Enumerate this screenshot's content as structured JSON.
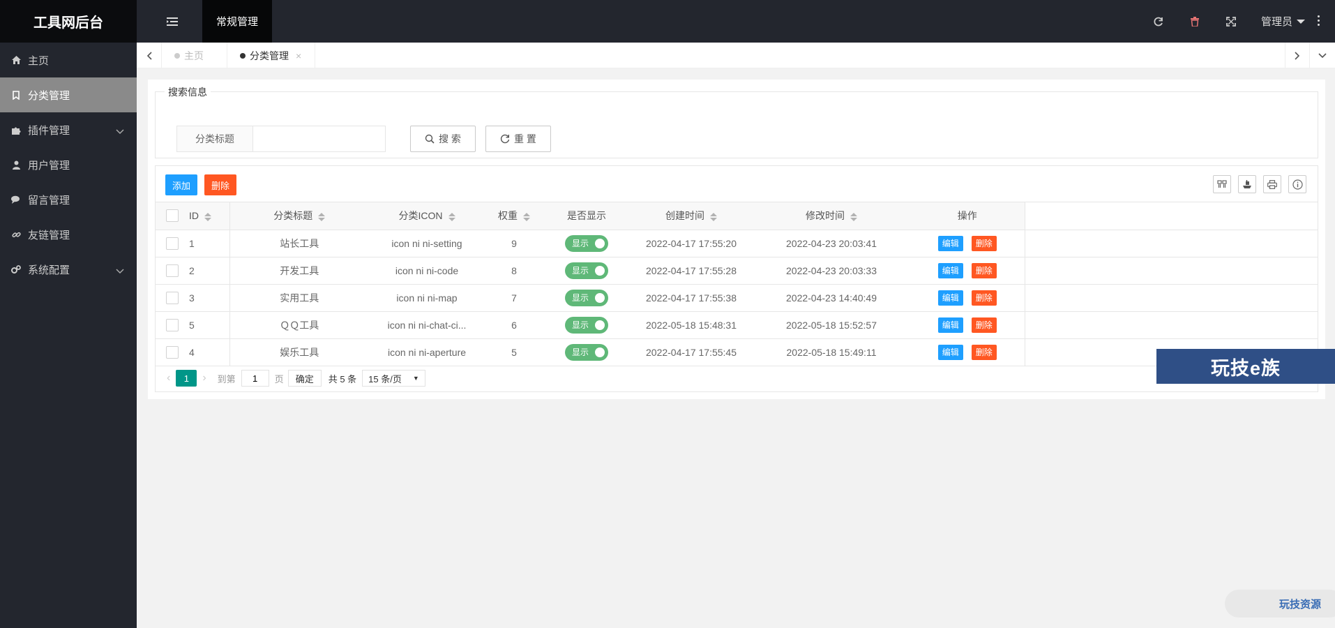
{
  "app": {
    "logo": "工具网后台",
    "top_tab": "常规管理",
    "admin_label": "管理员"
  },
  "icons": {
    "menu_toggle": "indent-icon",
    "refresh": "refresh-icon",
    "clear": "trash-icon",
    "fullscreen": "fullscreen-icon",
    "more": "more-vertical-icon"
  },
  "sidebar": {
    "items": [
      {
        "label": "主页",
        "icon": "home-icon"
      },
      {
        "label": "分类管理",
        "icon": "bookmark-icon",
        "active": true
      },
      {
        "label": "插件管理",
        "icon": "puzzle-icon",
        "expandable": true
      },
      {
        "label": "用户管理",
        "icon": "user-icon"
      },
      {
        "label": "留言管理",
        "icon": "chat-icon"
      },
      {
        "label": "友链管理",
        "icon": "link-icon"
      },
      {
        "label": "系统配置",
        "icon": "gears-icon",
        "expandable": true
      }
    ]
  },
  "tabs": {
    "home": "主页",
    "current": "分类管理"
  },
  "search": {
    "legend": "搜索信息",
    "field_label": "分类标题",
    "field_value": "",
    "search_btn": "搜 索",
    "reset_btn": "重 置"
  },
  "toolbar": {
    "add": "添加",
    "delete": "删除"
  },
  "table": {
    "headers": {
      "id": "ID",
      "title": "分类标题",
      "icon": "分类ICON",
      "weight": "权重",
      "show": "是否显示",
      "created": "创建时间",
      "modified": "修改时间",
      "ops": "操作"
    },
    "rows": [
      {
        "id": "1",
        "title": "站长工具",
        "icon": "icon ni ni-setting",
        "weight": "9",
        "show": "显示",
        "created": "2022-04-17 17:55:20",
        "modified": "2022-04-23 20:03:41"
      },
      {
        "id": "2",
        "title": "开发工具",
        "icon": "icon ni ni-code",
        "weight": "8",
        "show": "显示",
        "created": "2022-04-17 17:55:28",
        "modified": "2022-04-23 20:03:33"
      },
      {
        "id": "3",
        "title": "实用工具",
        "icon": "icon ni ni-map",
        "weight": "7",
        "show": "显示",
        "created": "2022-04-17 17:55:38",
        "modified": "2022-04-23 14:40:49"
      },
      {
        "id": "5",
        "title": "ＱＱ工具",
        "icon": "icon ni ni-chat-ci...",
        "weight": "6",
        "show": "显示",
        "created": "2022-05-18 15:48:31",
        "modified": "2022-05-18 15:52:57"
      },
      {
        "id": "4",
        "title": "娱乐工具",
        "icon": "icon ni ni-aperture",
        "weight": "5",
        "show": "显示",
        "created": "2022-04-17 17:55:45",
        "modified": "2022-05-18 15:49:11"
      }
    ],
    "edit_label": "编辑",
    "delete_label": "删除"
  },
  "pager": {
    "current": "1",
    "goto": "到第",
    "page_input": "1",
    "page_unit": "页",
    "confirm": "确定",
    "total": "共 5 条",
    "per_page": "15 条/页"
  },
  "watermark": {
    "box": "玩技e族",
    "pill": "玩技资源"
  },
  "colors": {
    "header_bg": "#23262e",
    "primary": "#1e9fff",
    "danger": "#ff5722",
    "success": "#5fb878",
    "page_current": "#009688"
  }
}
